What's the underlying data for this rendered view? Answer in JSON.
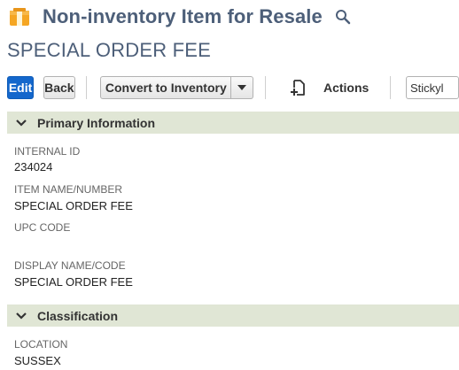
{
  "header": {
    "record_type": "Non-inventory Item for Resale",
    "record_name": "SPECIAL ORDER FEE"
  },
  "toolbar": {
    "edit_label": "Edit",
    "back_label": "Back",
    "convert_label": "Convert to Inventory",
    "actions_label": "Actions",
    "sticky_value": "Stickyl"
  },
  "sections": {
    "primary": {
      "title": "Primary Information",
      "fields": [
        {
          "label": "INTERNAL ID",
          "value": "234024"
        },
        {
          "label": "ITEM NAME/NUMBER",
          "value": "SPECIAL ORDER FEE"
        },
        {
          "label": "UPC CODE",
          "value": ""
        },
        {
          "label": "DISPLAY NAME/CODE",
          "value": "SPECIAL ORDER FEE"
        }
      ]
    },
    "classification": {
      "title": "Classification",
      "fields": [
        {
          "label": "LOCATION",
          "value": "SUSSEX"
        }
      ]
    }
  },
  "colors": {
    "accent": "#1467cc",
    "title": "#4d5f79",
    "section_bg": "#e0e6d5"
  },
  "icons": {
    "app": "item-box-icon",
    "search": "search-icon",
    "actions": "add-document-icon",
    "caret": "caret-down-icon",
    "section_toggle": "chevron-down-icon"
  }
}
